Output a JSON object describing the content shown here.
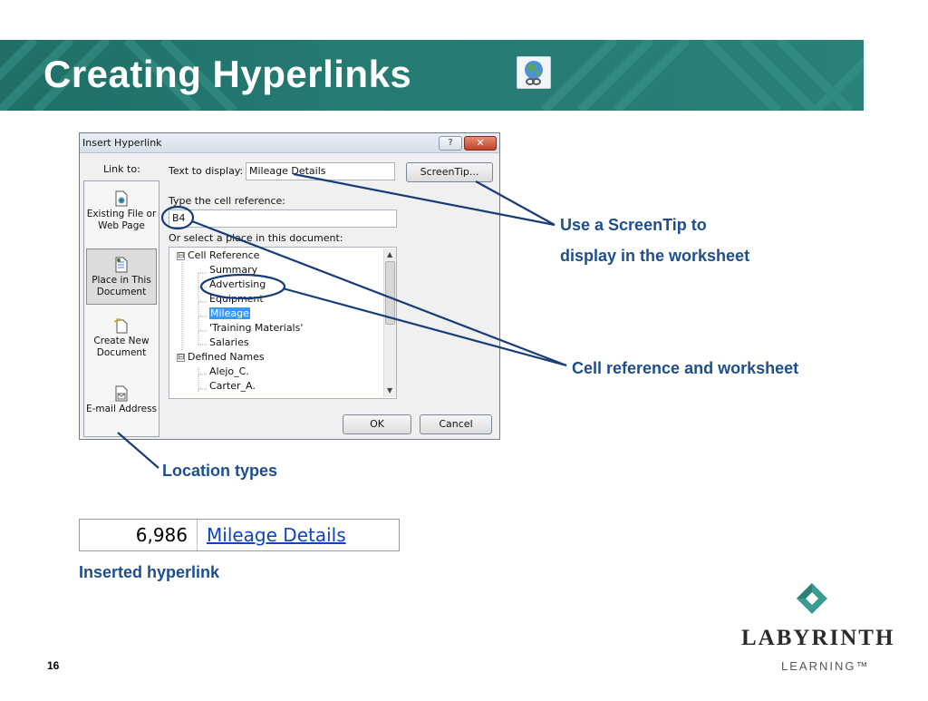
{
  "slide": {
    "title": "Creating Hyperlinks",
    "title_icon": "hyperlink-globe-icon",
    "page_number": "16"
  },
  "dialog": {
    "title": "Insert Hyperlink",
    "help_label": "?",
    "close_label": "✕",
    "link_to_label": "Link to:",
    "link_to_items": [
      {
        "label": "Existing File or Web Page",
        "icon": "file-icon",
        "selected": false
      },
      {
        "label": "Place in This Document",
        "icon": "document-place-icon",
        "selected": true
      },
      {
        "label": "Create New Document",
        "icon": "new-document-icon",
        "selected": false
      },
      {
        "label": "E-mail Address",
        "icon": "email-icon",
        "selected": false
      }
    ],
    "text_to_display_label": "Text to display:",
    "text_to_display_value": "Mileage Details",
    "screentip_button": "ScreenTip...",
    "cell_reference_label": "Type the cell reference:",
    "cell_reference_value": "B4",
    "place_label": "Or select a place in this document:",
    "tree": [
      {
        "label": "Cell Reference",
        "level": 0,
        "expander": "⊟",
        "selected": false
      },
      {
        "label": "Summary",
        "level": 1,
        "selected": false
      },
      {
        "label": "Advertising",
        "level": 1,
        "selected": false
      },
      {
        "label": "Equipment",
        "level": 1,
        "selected": false
      },
      {
        "label": "Mileage",
        "level": 1,
        "selected": true
      },
      {
        "label": "'Training Materials'",
        "level": 1,
        "selected": false
      },
      {
        "label": "Salaries",
        "level": 1,
        "selected": false
      },
      {
        "label": "Defined Names",
        "level": 0,
        "expander": "⊟",
        "selected": false
      },
      {
        "label": "Alejo_C.",
        "level": 1,
        "selected": false
      },
      {
        "label": "Carter_A.",
        "level": 1,
        "selected": false
      }
    ],
    "ok_button": "OK",
    "cancel_button": "Cancel"
  },
  "callouts": {
    "screentip_line1": "Use a ScreenTip to",
    "screentip_line2": "display in the worksheet",
    "cell_reference": "Cell reference and worksheet",
    "location_types": "Location types",
    "inserted_hyperlink": "Inserted hyperlink"
  },
  "cell_example": {
    "number": "6,986",
    "link_text": "Mileage Details"
  },
  "logo": {
    "name": "LABYRINTH",
    "sub": "LEARNING™"
  },
  "colors": {
    "banner": "#257a72",
    "callout": "#1d4e8f",
    "link": "#0b45c4",
    "selection": "#3399ff"
  }
}
